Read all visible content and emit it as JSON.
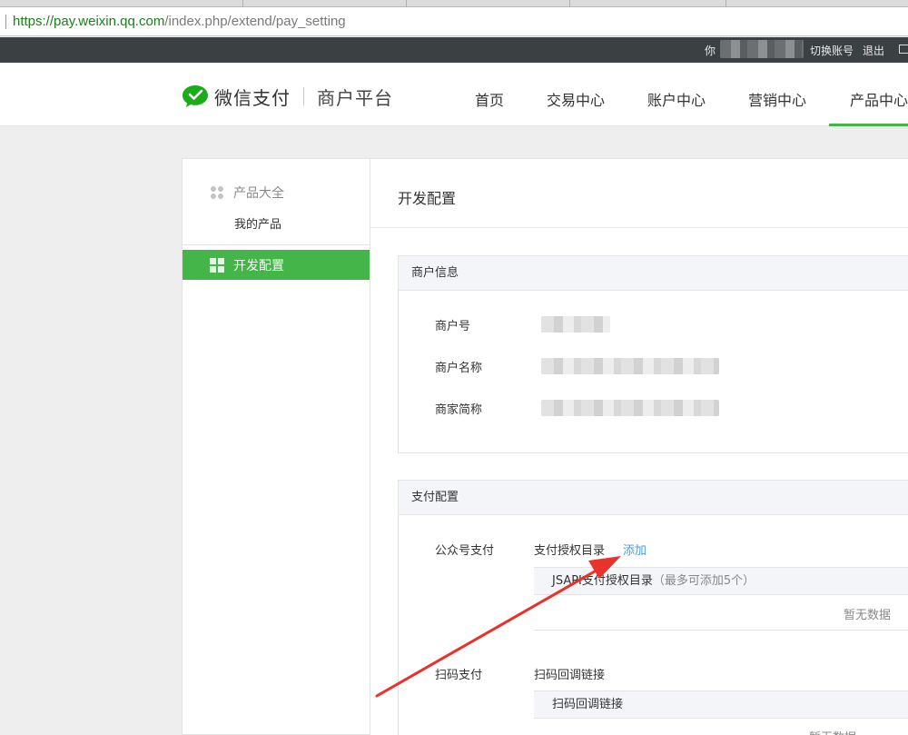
{
  "browser": {
    "url_scheme": "https://",
    "url_host": "pay.weixin.qq.com",
    "url_path": "/index.php/extend/pay_setting"
  },
  "topbar": {
    "greeting": "你",
    "switch_account": "切换账号",
    "logout": "退出"
  },
  "header": {
    "brand": "微信支付",
    "platform": "商户平台",
    "nav": [
      "首页",
      "交易中心",
      "账户中心",
      "营销中心",
      "产品中心"
    ],
    "accent_color": "#44b549"
  },
  "sidebar": {
    "group_title": "产品大全",
    "sub_item": "我的产品",
    "active_item": "开发配置"
  },
  "main": {
    "title": "开发配置",
    "merchant_card": {
      "title": "商户信息",
      "rows": [
        {
          "label": "商户号"
        },
        {
          "label": "商户名称"
        },
        {
          "label": "商家简称"
        }
      ]
    },
    "pay_card": {
      "title": "支付配置",
      "jsapi": {
        "label": "公众号支付",
        "dir_label": "支付授权目录",
        "add_link": "添加",
        "table_head": "JSAPI支付授权目录",
        "table_hint": "（最多可添加5个）",
        "empty": "暂无数据"
      },
      "native": {
        "label": "扫码支付",
        "dir_label": "扫码回调链接",
        "table_head": "扫码回调链接",
        "empty": "暂无数据"
      }
    }
  }
}
